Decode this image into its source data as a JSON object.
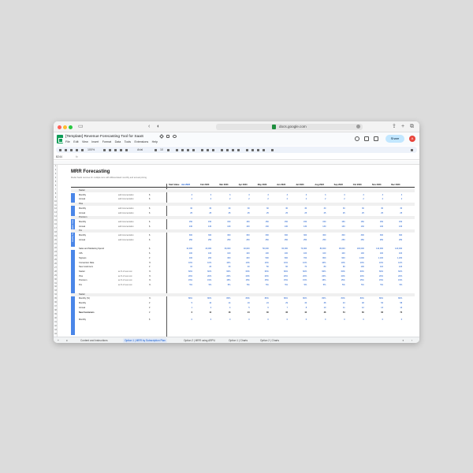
{
  "browser": {
    "url": "docs.google.com"
  },
  "app": {
    "title": "[Template] Revenue Forecasting Tool for SaaS",
    "menu": [
      "File",
      "Edit",
      "View",
      "Insert",
      "Format",
      "Data",
      "Tools",
      "Extensions",
      "Help"
    ],
    "share_label": "Share",
    "avatar_initial": "A"
  },
  "toolbar": {
    "zoom": "100%",
    "font": "Arial",
    "font_size": "10"
  },
  "formula_bar": {
    "cell_ref": "B244"
  },
  "sheet": {
    "title": "MRR Forecasting",
    "subtitle": "Model SaaS revenue for multiple tiers with differentiated monthly and annual pricing",
    "start_value_label": "Start Value",
    "months": [
      "Jan 2023",
      "Feb 2023",
      "Mar 2023",
      "Apr 2023",
      "May 2023",
      "Jun 2023",
      "Jul 2023",
      "Aug 2023",
      "Sep 2023",
      "Oct 2023",
      "Nov 2023",
      "Dec 2023"
    ],
    "side_label": "Monthly Subscription Fees",
    "rows": [
      {
        "label": "Starter",
        "bold": false,
        "section": true
      },
      {
        "label": "Monthly",
        "note": "add incrementation",
        "unit": "$",
        "values": [
          "3",
          "3",
          "3",
          "3",
          "3",
          "3",
          "3",
          "3",
          "3",
          "3",
          "3",
          "3"
        ]
      },
      {
        "label": "Annual",
        "note": "add incrementation",
        "unit": "$",
        "values": [
          "2",
          "2",
          "2",
          "2",
          "2",
          "2",
          "2",
          "2",
          "2",
          "2",
          "2",
          "2"
        ]
      },
      {
        "label": "Plus",
        "section": true
      },
      {
        "label": "Monthly",
        "note": "add incrementation",
        "unit": "$",
        "values": [
          "30",
          "30",
          "30",
          "30",
          "30",
          "30",
          "30",
          "30",
          "30",
          "30",
          "30",
          "30"
        ]
      },
      {
        "label": "Annual",
        "note": "add incrementation",
        "unit": "$",
        "values": [
          "25",
          "25",
          "25",
          "25",
          "25",
          "25",
          "25",
          "25",
          "25",
          "25",
          "25",
          "25"
        ]
      },
      {
        "label": "Premium",
        "section": true
      },
      {
        "label": "Monthly",
        "note": "add incrementation",
        "unit": "$",
        "values": [
          "150",
          "150",
          "150",
          "150",
          "150",
          "150",
          "150",
          "150",
          "150",
          "150",
          "150",
          "150"
        ]
      },
      {
        "label": "Annual",
        "note": "add incrementation",
        "unit": "$",
        "values": [
          "130",
          "130",
          "130",
          "130",
          "130",
          "130",
          "130",
          "130",
          "130",
          "130",
          "130",
          "130"
        ]
      },
      {
        "label": "Pro",
        "section": true
      },
      {
        "label": "Monthly",
        "note": "add incrementation",
        "unit": "$",
        "values": [
          "300",
          "300",
          "300",
          "300",
          "300",
          "300",
          "300",
          "300",
          "300",
          "300",
          "300",
          "300"
        ]
      },
      {
        "label": "Annual",
        "note": "add incrementation",
        "unit": "$",
        "values": [
          "250",
          "250",
          "250",
          "250",
          "250",
          "250",
          "250",
          "250",
          "250",
          "250",
          "250",
          "250"
        ]
      },
      {
        "label": "Sales and Marketing Spend",
        "unit": "$",
        "values": [
          "10,000",
          "20,000",
          "30,000",
          "40,000",
          "50,000",
          "60,000",
          "70,000",
          "80,000",
          "90,000",
          "100,000",
          "110,000",
          "120,000"
        ]
      },
      {
        "label": "CPL",
        "unit": "$",
        "values": [
          "100",
          "100",
          "100",
          "100",
          "100",
          "100",
          "100",
          "100",
          "100",
          "100",
          "100",
          "100"
        ]
      },
      {
        "label": "Signups",
        "unit": "#",
        "values": [
          "100",
          "200",
          "300",
          "400",
          "500",
          "600",
          "700",
          "800",
          "900",
          "1,000",
          "1,100",
          "1,200"
        ]
      },
      {
        "label": "Conversion Rate",
        "unit": "%",
        "values": [
          "10%",
          "10%",
          "10%",
          "10%",
          "10%",
          "10%",
          "10%",
          "10%",
          "10%",
          "10%",
          "10%",
          "10%"
        ]
      },
      {
        "label": "New customers",
        "unit": "#",
        "values": [
          "10",
          "20",
          "30",
          "40",
          "50",
          "60",
          "70",
          "80",
          "90",
          "100",
          "110",
          "120"
        ]
      },
      {
        "label": "Starter",
        "note": "as % of new cust",
        "unit": "%",
        "values": [
          "60%",
          "60%",
          "60%",
          "60%",
          "60%",
          "60%",
          "60%",
          "60%",
          "60%",
          "60%",
          "60%",
          "60%"
        ]
      },
      {
        "label": "Plus",
        "note": "as % of new cust",
        "unit": "%",
        "values": [
          "20%",
          "20%",
          "20%",
          "20%",
          "20%",
          "20%",
          "20%",
          "20%",
          "20%",
          "20%",
          "20%",
          "20%"
        ]
      },
      {
        "label": "Premium",
        "note": "as % of new cust",
        "unit": "%",
        "values": [
          "15%",
          "15%",
          "15%",
          "15%",
          "15%",
          "15%",
          "15%",
          "15%",
          "15%",
          "15%",
          "15%",
          "15%"
        ]
      },
      {
        "label": "Pro",
        "note": "as % of new cust",
        "unit": "%",
        "values": [
          "5%",
          "5%",
          "5%",
          "5%",
          "5%",
          "5%",
          "5%",
          "5%",
          "5%",
          "5%",
          "5%",
          "5%"
        ]
      },
      {
        "label": "Starter",
        "section": true
      },
      {
        "label": "Monthly (%)",
        "unit": "%",
        "values": [
          "80%",
          "80%",
          "80%",
          "80%",
          "80%",
          "80%",
          "80%",
          "80%",
          "80%",
          "80%",
          "80%",
          "80%"
        ]
      },
      {
        "label": "Monthly",
        "unit": "#",
        "values": [
          "5",
          "10",
          "14",
          "19",
          "24",
          "29",
          "34",
          "38",
          "43",
          "48",
          "53",
          "58"
        ]
      },
      {
        "label": "Annual",
        "unit": "#",
        "values": [
          "1",
          "2",
          "4",
          "5",
          "6",
          "7",
          "8",
          "10",
          "11",
          "12",
          "13",
          "14"
        ]
      },
      {
        "label": "New Customers",
        "bold": true,
        "unit": "#",
        "values": [
          "6",
          "12",
          "18",
          "24",
          "30",
          "36",
          "42",
          "48",
          "54",
          "60",
          "66",
          "72"
        ]
      },
      {
        "label": "Monthly",
        "unit": "$",
        "values": [
          "0",
          "0",
          "0",
          "0",
          "0",
          "0",
          "0",
          "0",
          "0",
          "0",
          "0",
          "0"
        ]
      }
    ]
  },
  "tabs": [
    {
      "label": "Content and Instructions",
      "active": false
    },
    {
      "label": "Option 1 | MRR by Subscription Plan",
      "active": true
    },
    {
      "label": "Option 2 | MRR using ARPU",
      "active": false
    },
    {
      "label": "Option 1 | Charts",
      "active": false
    },
    {
      "label": "Option 2 | Charts",
      "active": false
    }
  ],
  "colors": {
    "accent_blue": "#4a86e8",
    "value_blue": "#1155cc",
    "share_bg": "#c2e7ff",
    "sheets_green": "#0f9d58"
  }
}
